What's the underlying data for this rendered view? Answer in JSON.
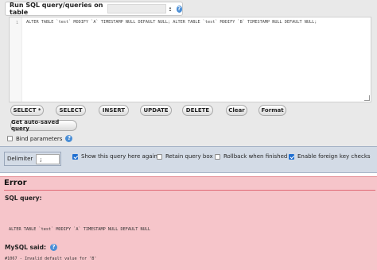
{
  "sql_panel": {
    "legend_label": "Run SQL query/queries on table",
    "legend_colon": ":",
    "help_glyph": "?",
    "line_number": "1",
    "query_text": "ALTER TABLE `test` MODIFY `A` TIMESTAMP NULL DEFAULT NULL; ALTER TABLE `test` MODIFY `B` TIMESTAMP NULL DEFAULT NULL;"
  },
  "buttons": {
    "select_star": "SELECT *",
    "select": "SELECT",
    "insert": "INSERT",
    "update": "UPDATE",
    "delete": "DELETE",
    "clear": "Clear",
    "format": "Format",
    "get_auto_saved": "Get auto-saved query"
  },
  "bind_parameters": {
    "label": "Bind parameters",
    "checked": false
  },
  "options": {
    "delimiter_label": "Delimiter",
    "delimiter_value": ";",
    "show_query_here_again": {
      "label": "Show this query here again",
      "checked": true
    },
    "retain_query_box": {
      "label": "Retain query box",
      "checked": false
    },
    "rollback_when_finished": {
      "label": "Rollback when finished",
      "checked": false
    },
    "enable_foreign_key_checks": {
      "label": "Enable foreign key checks",
      "checked": true
    }
  },
  "error": {
    "title": "Error",
    "sql_query_label": "SQL query:",
    "sql_query_text": "ALTER TABLE `test` MODIFY `A` TIMESTAMP NULL DEFAULT NULL",
    "mysql_said_label": "MySQL said:",
    "message": "#1067 - Invalid default value for 'B'"
  },
  "colors": {
    "error_background": "#f6c5ca",
    "options_background": "#d3dbe6",
    "checkbox_checked": "#1f6fd1"
  }
}
